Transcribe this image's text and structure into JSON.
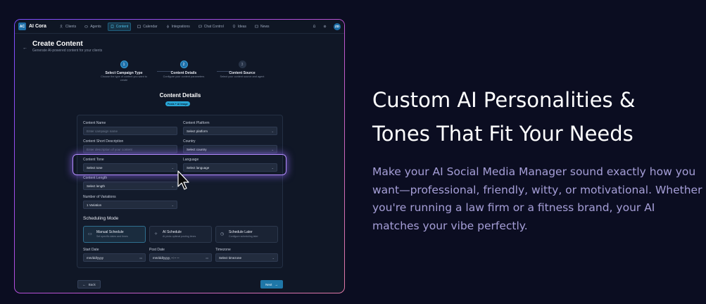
{
  "nav": {
    "logo_badge": "AC",
    "app_name": "AI Cora",
    "items": [
      {
        "label": "Clients",
        "icon": "users-icon"
      },
      {
        "label": "Agents",
        "icon": "bot-icon"
      },
      {
        "label": "Content",
        "icon": "document-icon",
        "active": true
      },
      {
        "label": "Calendar",
        "icon": "calendar-icon"
      },
      {
        "label": "Integrations",
        "icon": "plug-icon"
      },
      {
        "label": "Chat Control",
        "icon": "chat-icon"
      },
      {
        "label": "Ideas",
        "icon": "lightbulb-icon"
      },
      {
        "label": "News",
        "icon": "newspaper-icon"
      }
    ],
    "avatar": "ZD"
  },
  "header": {
    "title": "Create Content",
    "subtitle": "Generate AI-powered content for your clients"
  },
  "steps": [
    {
      "number": "1",
      "title": "Select Campaign Type",
      "desc": "Choose the type of content you want to create"
    },
    {
      "number": "2",
      "title": "Content Details",
      "desc": "Configure your content parameters"
    },
    {
      "number": "3",
      "title": "Content Source",
      "desc": "Select your content source and agent"
    }
  ],
  "section": {
    "title": "Content Details",
    "pill": "Posts + AI Image"
  },
  "form": {
    "content_name_label": "Content Name",
    "content_name_placeholder": "Enter campaign name",
    "platform_label": "Content Platform",
    "platform_value": "Select platform",
    "short_desc_label": "Content Short Description",
    "short_desc_placeholder": "Enter description of your content",
    "country_label": "Country",
    "country_value": "Select country",
    "tone_label": "Content Tone",
    "tone_value": "Select tone",
    "language_label": "Language",
    "language_value": "Select language",
    "length_label": "Content Length",
    "length_value": "Select length",
    "variations_label": "Number of Variations",
    "variations_value": "1 Variation"
  },
  "scheduling": {
    "title": "Scheduling Mode",
    "options": [
      {
        "title": "Manual Schedule",
        "desc": "Set specific dates and times"
      },
      {
        "title": "AI Schedule",
        "desc": "AI picks optimal posting times"
      },
      {
        "title": "Schedule Later",
        "desc": "Configure scheduling later"
      }
    ],
    "start_label": "Start Date",
    "start_placeholder": "mm/dd/yyyy",
    "post_label": "Post Date",
    "post_placeholder": "mm/dd/yyyy, --:-- --",
    "timezone_label": "Timezone",
    "timezone_value": "Select timezone"
  },
  "footer": {
    "back_label": "Back",
    "next_label": "Next"
  },
  "marketing": {
    "headline_line1": "Custom AI Personalities &",
    "headline_line2": "Tones That Fit Your Needs",
    "paragraph": "Make your AI Social Media Manager sound exactly how you want—professional, friendly, witty, or motivational. Whether you're running a law firm or a fitness brand, your AI matches your vibe perfectly."
  }
}
